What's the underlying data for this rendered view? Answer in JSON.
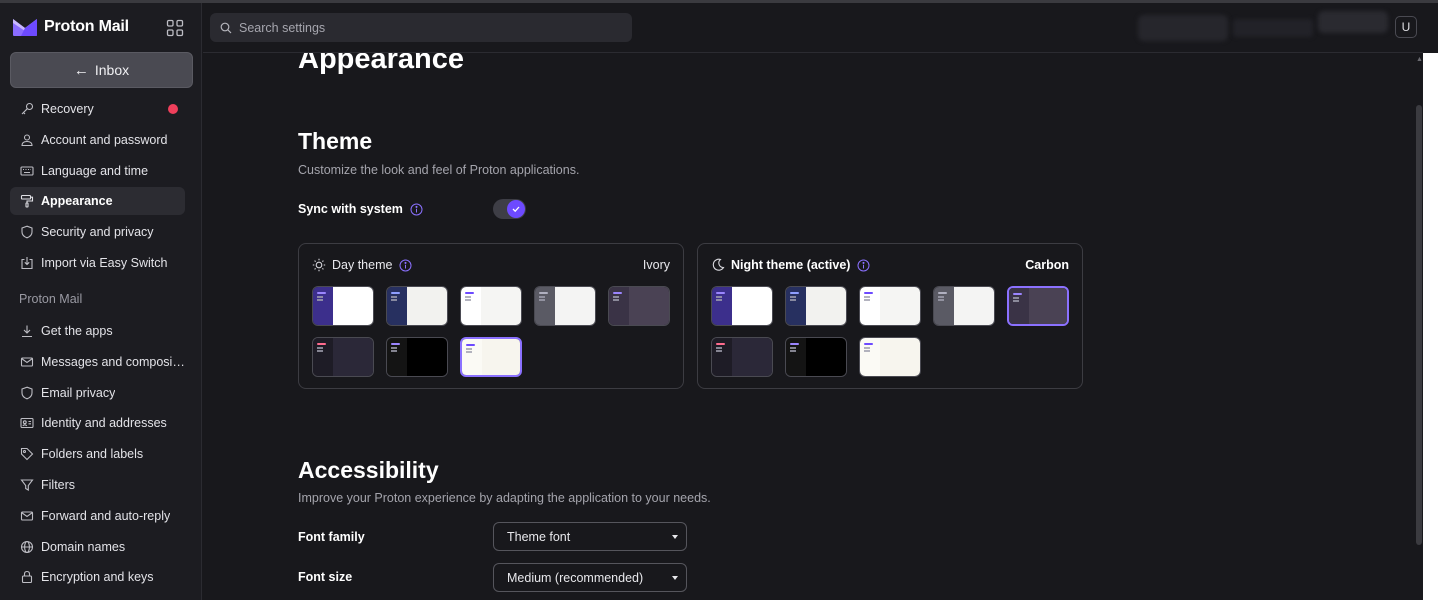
{
  "app": {
    "brand": "Proton Mail"
  },
  "sidebar": {
    "back_button": "Inbox",
    "items": [
      {
        "label": "Recovery",
        "icon": "key-icon",
        "badge": true
      },
      {
        "label": "Account and password",
        "icon": "user-icon"
      },
      {
        "label": "Language and time",
        "icon": "keyboard-icon"
      },
      {
        "label": "Appearance",
        "icon": "paint-roller-icon",
        "active": true
      },
      {
        "label": "Security and privacy",
        "icon": "shield-icon"
      },
      {
        "label": "Import via Easy Switch",
        "icon": "import-icon"
      }
    ],
    "section_mail": "Proton Mail",
    "mail_items": [
      {
        "label": "Get the apps",
        "icon": "download-icon"
      },
      {
        "label": "Messages and composi…",
        "icon": "envelope-icon"
      },
      {
        "label": "Email privacy",
        "icon": "shield-icon"
      },
      {
        "label": "Identity and addresses",
        "icon": "id-card-icon"
      },
      {
        "label": "Folders and labels",
        "icon": "tag-icon"
      },
      {
        "label": "Filters",
        "icon": "filter-icon"
      },
      {
        "label": "Forward and auto-reply",
        "icon": "forward-envelope-icon"
      },
      {
        "label": "Domain names",
        "icon": "globe-icon"
      },
      {
        "label": "Encryption and keys",
        "icon": "lock-icon"
      }
    ]
  },
  "header": {
    "search_placeholder": "Search settings",
    "avatar_initial": "U"
  },
  "main": {
    "page_title": "Appearance",
    "theme": {
      "title": "Theme",
      "description": "Customize the look and feel of Proton applications.",
      "sync_label": "Sync with system",
      "sync_enabled": true,
      "day_panel": {
        "label": "Day theme",
        "value": "Ivory"
      },
      "night_panel": {
        "label": "Night theme (active)",
        "value": "Carbon"
      }
    },
    "accessibility": {
      "title": "Accessibility",
      "description": "Improve your Proton experience by adapting the application to your needs.",
      "font_family_label": "Font family",
      "font_family_value": "Theme font",
      "font_size_label": "Font size",
      "font_size_value": "Medium (recommended)"
    }
  },
  "colors": {
    "accent": "#6d4aff",
    "badge": "#ef3f5b",
    "background": "#18181c"
  }
}
